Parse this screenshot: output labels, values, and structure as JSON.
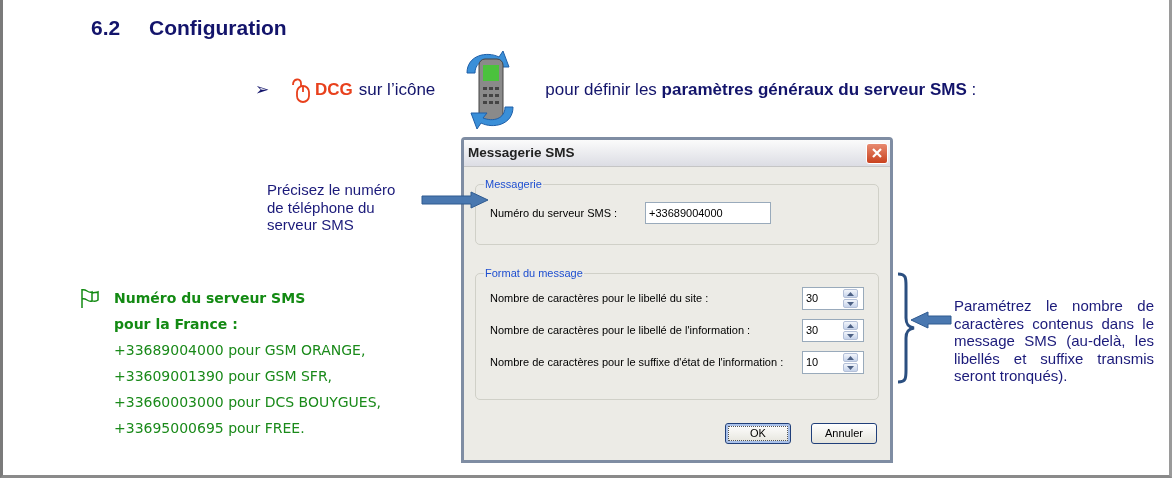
{
  "heading": {
    "number": "6.2",
    "title": "Configuration"
  },
  "instruction": {
    "bullet": "➢",
    "action": "DCG",
    "text": "sur l’icône",
    "description": "pour définir les **paramètres généraux du serveur SMS** :"
  },
  "phone_callout": {
    "text": "Précisez le numéro de téléphone du serveur SMS"
  },
  "format_callout": {
    "text": "Paramétrez le nombre de caractères contenus dans le message SMS (au-delà, les libellés et suffixe transmis seront tronqués)."
  },
  "dialog": {
    "title": "Messagerie SMS",
    "groups": [
      {
        "title": "Messagerie",
        "fields": [
          {
            "kind": "text",
            "label": "Numéro du serveur SMS :",
            "value": "+33689004000"
          }
        ]
      },
      {
        "title": "Format du message",
        "fields": [
          {
            "kind": "spin",
            "label": "Nombre de caractères pour le libellé du site :",
            "value": "30"
          },
          {
            "kind": "spin",
            "label": "Nombre de caractères pour le libellé de l'information :",
            "value": "30"
          },
          {
            "kind": "spin",
            "label": "Nombre de caractères pour le suffixe d'état de l'information :",
            "value": "10"
          }
        ]
      }
    ],
    "buttons": [
      {
        "label": "OK",
        "default": true
      },
      {
        "label": "Annuler",
        "default": false
      }
    ]
  },
  "note": {
    "title_lines": [
      "Numéro du serveur SMS",
      "pour la France :"
    ],
    "lines": [
      "+33689004000 pour GSM ORANGE,",
      "+33609001390 pour GSM SFR,",
      "+33660003000 pour DCS BOUYGUES,",
      "+33695000695 pour FREE."
    ]
  }
}
